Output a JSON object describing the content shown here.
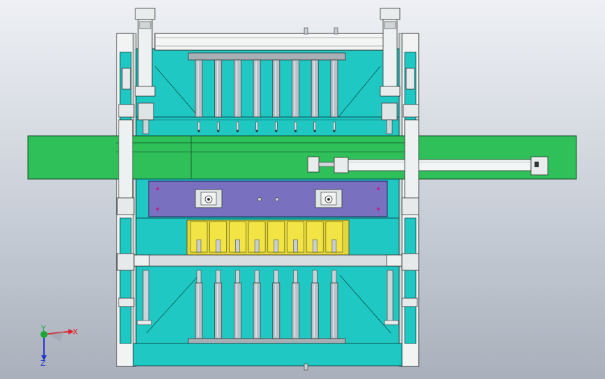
{
  "view": {
    "background_top": "#eef0f4",
    "background_bottom": "#a9b0bb"
  },
  "colors": {
    "frame_teal": "#20c8c4",
    "frame_dark": "#0e8e8a",
    "green_beam": "#2fc05a",
    "purple_plate": "#7a70c0",
    "yellow_fins": "#f2e444",
    "steel": "#b9c0c6",
    "steel_dark": "#6f777d"
  },
  "triad": {
    "x_label": "X",
    "y_label": "Y",
    "z_label": "Z",
    "x_color": "#e0202a",
    "y_color": "#18a83a",
    "z_color": "#2636c8"
  },
  "icons": [
    "axis-triad-icon"
  ],
  "counts": {
    "upper_rods": 8,
    "lower_rods": 8,
    "yellow_fins": 8
  }
}
